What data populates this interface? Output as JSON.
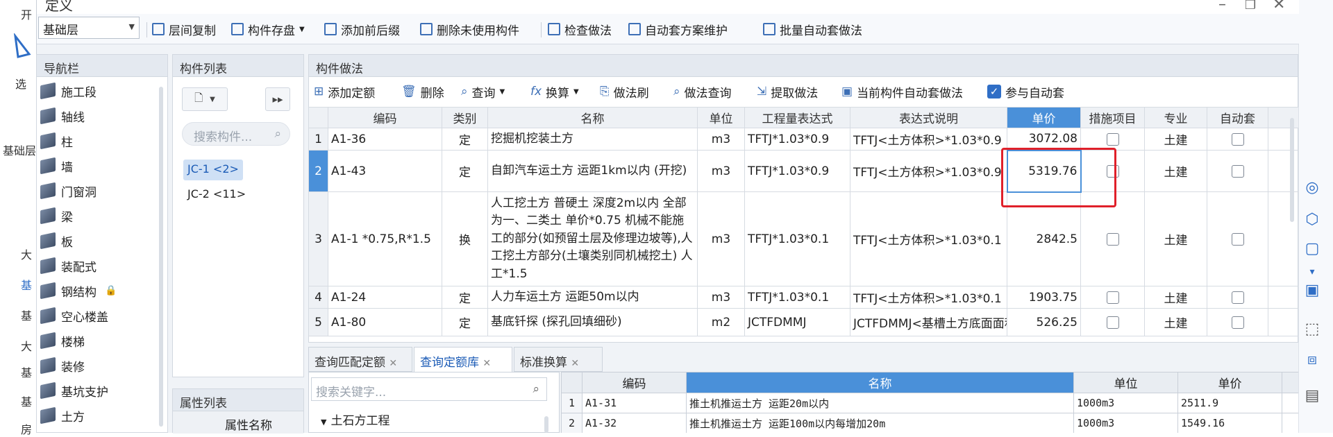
{
  "background_app": {
    "left_texts": [
      "开",
      "选",
      "基础层",
      "大",
      "基",
      "基",
      "大",
      "基",
      "基",
      "房"
    ],
    "left_icon": "triangle-icon"
  },
  "window": {
    "title": "定义",
    "controls": [
      "minimize-icon",
      "restore-icon",
      "close-icon"
    ]
  },
  "toolbar": {
    "floor_combo": "基础层",
    "buttons": [
      "层间复制",
      "构件存盘",
      "添加前后缀",
      "删除未使用构件",
      "检查做法",
      "自动套方案维护",
      "批量自动套做法"
    ]
  },
  "nav": {
    "title": "导航栏",
    "items": [
      "施工段",
      "轴线",
      "柱",
      "墙",
      "门窗洞",
      "梁",
      "板",
      "装配式",
      "钢结构",
      "空心楼盖",
      "楼梯",
      "装修",
      "基坑支护",
      "土方"
    ]
  },
  "component_list": {
    "title": "构件列表",
    "search_placeholder": "搜索构件...",
    "items": [
      "JC-1 <2>",
      "JC-2 <11>"
    ]
  },
  "property_list": {
    "title": "属性列表",
    "col_header": "属性名称"
  },
  "method": {
    "title": "构件做法",
    "toolbar": [
      "添加定额",
      "删除",
      "查询",
      "换算",
      "做法刷",
      "做法查询",
      "提取做法",
      "当前构件自动套做法"
    ],
    "auto_check_label": "参与自动套",
    "columns": [
      "编码",
      "类别",
      "名称",
      "单位",
      "工程量表达式",
      "表达式说明",
      "单价",
      "措施项目",
      "专业",
      "自动套"
    ],
    "rows": [
      {
        "idx": "1",
        "code": "A1-36",
        "type": "定",
        "name": "挖掘机挖装土方",
        "unit": "m3",
        "expr": "TFTJ*1.03*0.9",
        "desc": "TFTJ<土方体积>*1.03*0.9",
        "price": "3072.08",
        "spec": "土建"
      },
      {
        "idx": "2",
        "code": "A1-43",
        "type": "定",
        "name": "自卸汽车运土方 运距1km以内 (开挖)",
        "unit": "m3",
        "expr": "TFTJ*1.03*0.9",
        "desc": "TFTJ<土方体积>*1.03*0.9",
        "price": "5319.76",
        "spec": "土建"
      },
      {
        "idx": "3",
        "code": "A1-1 *0.75,R*1.5",
        "type": "换",
        "name": "人工挖土方 普硬土 深度2m以内 全部为一、二类土 单价*0.75 机械不能施工的部分(如预留土层及修理边坡等),人工挖土方部分(土壤类别同机械挖土) 人工*1.5",
        "unit": "m3",
        "expr": "TFTJ*1.03*0.1",
        "desc": "TFTJ<土方体积>*1.03*0.1",
        "price": "2842.5",
        "spec": "土建"
      },
      {
        "idx": "4",
        "code": "A1-24",
        "type": "定",
        "name": "人力车运土方 运距50m以内",
        "unit": "m3",
        "expr": "TFTJ*1.03*0.1",
        "desc": "TFTJ<土方体积>*1.03*0.1",
        "price": "1903.75",
        "spec": "土建"
      },
      {
        "idx": "5",
        "code": "A1-80",
        "type": "定",
        "name": "基底钎探 (探孔回填细砂)",
        "unit": "m2",
        "expr": "JCTFDMMJ",
        "desc": "JCTFDMMJ<基槽土方底面面积>",
        "price": "526.25",
        "spec": "土建"
      }
    ]
  },
  "bottom": {
    "tabs": [
      "查询匹配定额",
      "查询定额库",
      "标准换算"
    ],
    "search_placeholder": "搜索关键字...",
    "tree_root": "土石方工程",
    "columns": [
      "编码",
      "名称",
      "单位",
      "单价"
    ],
    "rows": [
      {
        "idx": "1",
        "code": "A1-31",
        "name": "推土机推运土方 运距20m以内",
        "unit": "1000m3",
        "price": "2511.9"
      },
      {
        "idx": "2",
        "code": "A1-32",
        "name": "推土机推运土方 运距100m以内每增加20m",
        "unit": "1000m3",
        "price": "1549.16"
      }
    ]
  },
  "right_toolbar": [
    "circle-view-icon",
    "3d-icon",
    "cube-icon",
    "chevron-down-icon",
    "cube-outline-icon",
    "selection-icon",
    "box-select-icon",
    "panel-icon"
  ],
  "colors": {
    "accent": "#4a90d9",
    "highlight_box": "#e0202a"
  }
}
